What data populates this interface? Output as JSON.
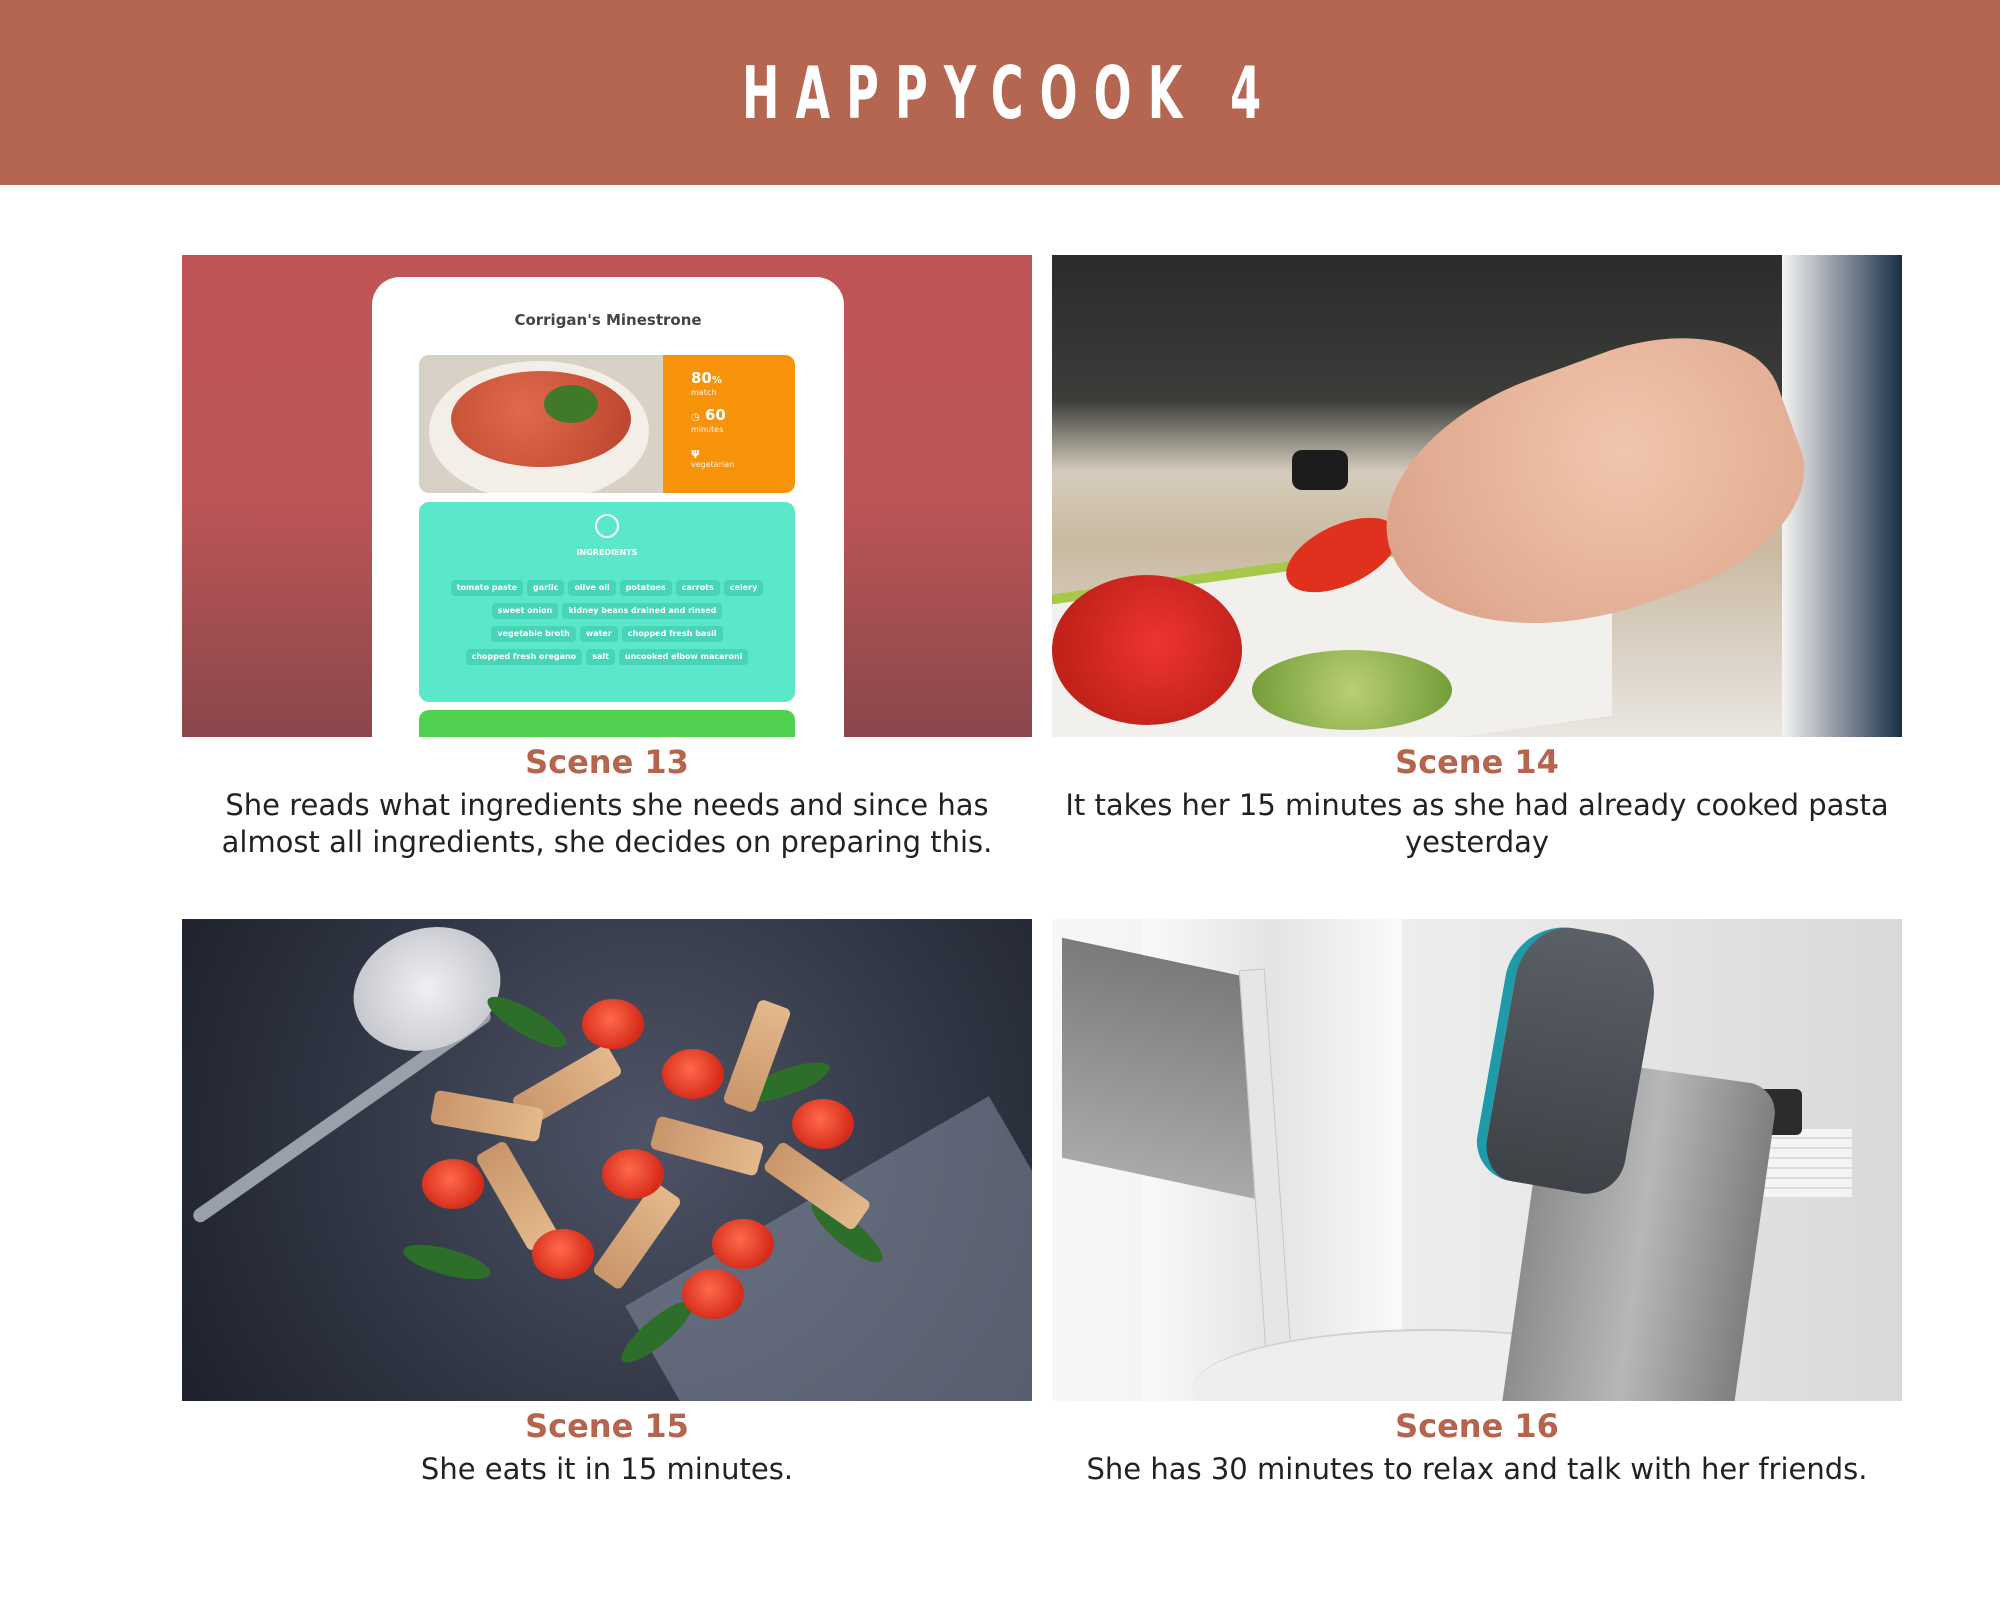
{
  "header": {
    "title": "HAPPYCOOK 4",
    "background": "#b56650"
  },
  "scenes": [
    {
      "title": "Scene 13",
      "description": "She reads what ingredients she needs and since has almost all ingredients, she decides on preparing this."
    },
    {
      "title": "Scene 14",
      "description": "It takes her 15 minutes as she had already cooked pasta yesterday"
    },
    {
      "title": "Scene 15",
      "description": "She eats it in 15 minutes."
    },
    {
      "title": "Scene 16",
      "description": "She has 30 minutes to relax and talk with her friends."
    }
  ],
  "recipe": {
    "name": "Corrigan's Minestrone",
    "match_value": "80",
    "match_unit": "%",
    "match_label": "match",
    "minutes_value": "60",
    "minutes_label": "minutes",
    "diet_label": "vegetarian",
    "ingredients_label": "INGREDIENTS",
    "ingredients": [
      "tomato paste",
      "garlic",
      "olive oil",
      "potatoes",
      "carrots",
      "celery",
      "sweet onion",
      "kidney beans drained and rinsed",
      "vegetable broth",
      "water",
      "chopped fresh basil",
      "chopped fresh oregano",
      "salt",
      "uncooked elbow macaroni"
    ]
  },
  "colors": {
    "accent": "#b5644d",
    "app_orange": "#f7930a",
    "app_teal": "#5be7c9",
    "app_green": "#4fd04f"
  }
}
